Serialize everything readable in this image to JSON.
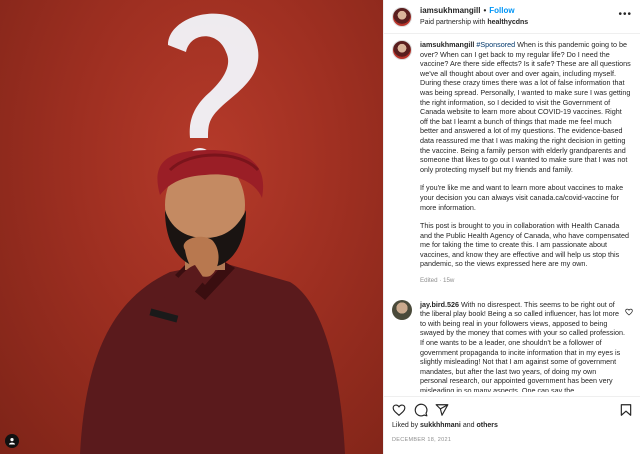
{
  "post": {
    "username": "iamsukhmangill",
    "follow_label": "Follow",
    "partnership_prefix": "Paid partnership with",
    "partner": "healthycdns",
    "more_label": "•••"
  },
  "caption": {
    "username": "iamsukhmangill",
    "hashtag": "#Sponsored",
    "para1": "When is this pandemic going to be over? When can I get back to my regular life? Do I need the vaccine? Are there side effects? Is it safe? These are all questions we've all thought about over and over again, including myself. During these crazy times there was a lot of false information that was being spread. Personally, I wanted to make sure I was getting the right information, so I decided to visit the Government of Canada website to learn more about COVID-19 vaccines. Right off the bat I learnt a bunch of things that made me feel much better and answered a lot of my questions. The evidence-based data reassured me that I was making the right decision in getting the vaccine. Being a family person with elderly grandparents and someone that likes to go out I wanted to make sure that I was not only protecting myself but my friends and family.",
    "para2": "If you're like me and want to learn more about vaccines to make your decision you can always visit canada.ca/covid-vaccine for more information.",
    "para3": "This post is brought to you in collaboration with Health Canada and the Public Health Agency of Canada, who have compensated me for taking the time to create this. I am passionate about vaccines, and know they are effective and will help us stop this pandemic, so the views expressed here are my own.",
    "edited": "Edited · 15w"
  },
  "comment": {
    "username": "jay.bird.526",
    "text": "With no disrespect. This seems to be right out of the liberal play book! Being a so called influencer, has lot more to with being real in your followers views, apposed to being swayed by the money that comes with your so called profession. If one wants to be a leader, one shouldn't be a follower of government propaganda to incite information that in my eyes is slightly misleading! Not that I am against some of government mandates, but after the last two years, of doing my own personal research, our appointed government has been very misleading in so many aspects. One can say the"
  },
  "likes": {
    "prefix": "Liked by",
    "user": "sukkhhmani",
    "middle": "and",
    "others": "others"
  },
  "date": "DECEMBER 18, 2021",
  "icons": {
    "like": "heart-icon",
    "comment": "comment-icon",
    "share": "share-icon",
    "save": "bookmark-icon",
    "user_tag": "user-tag-icon"
  },
  "colors": {
    "background_red": "#9e2f21",
    "link_blue": "#0095f6",
    "muted": "#8e8e8e"
  }
}
